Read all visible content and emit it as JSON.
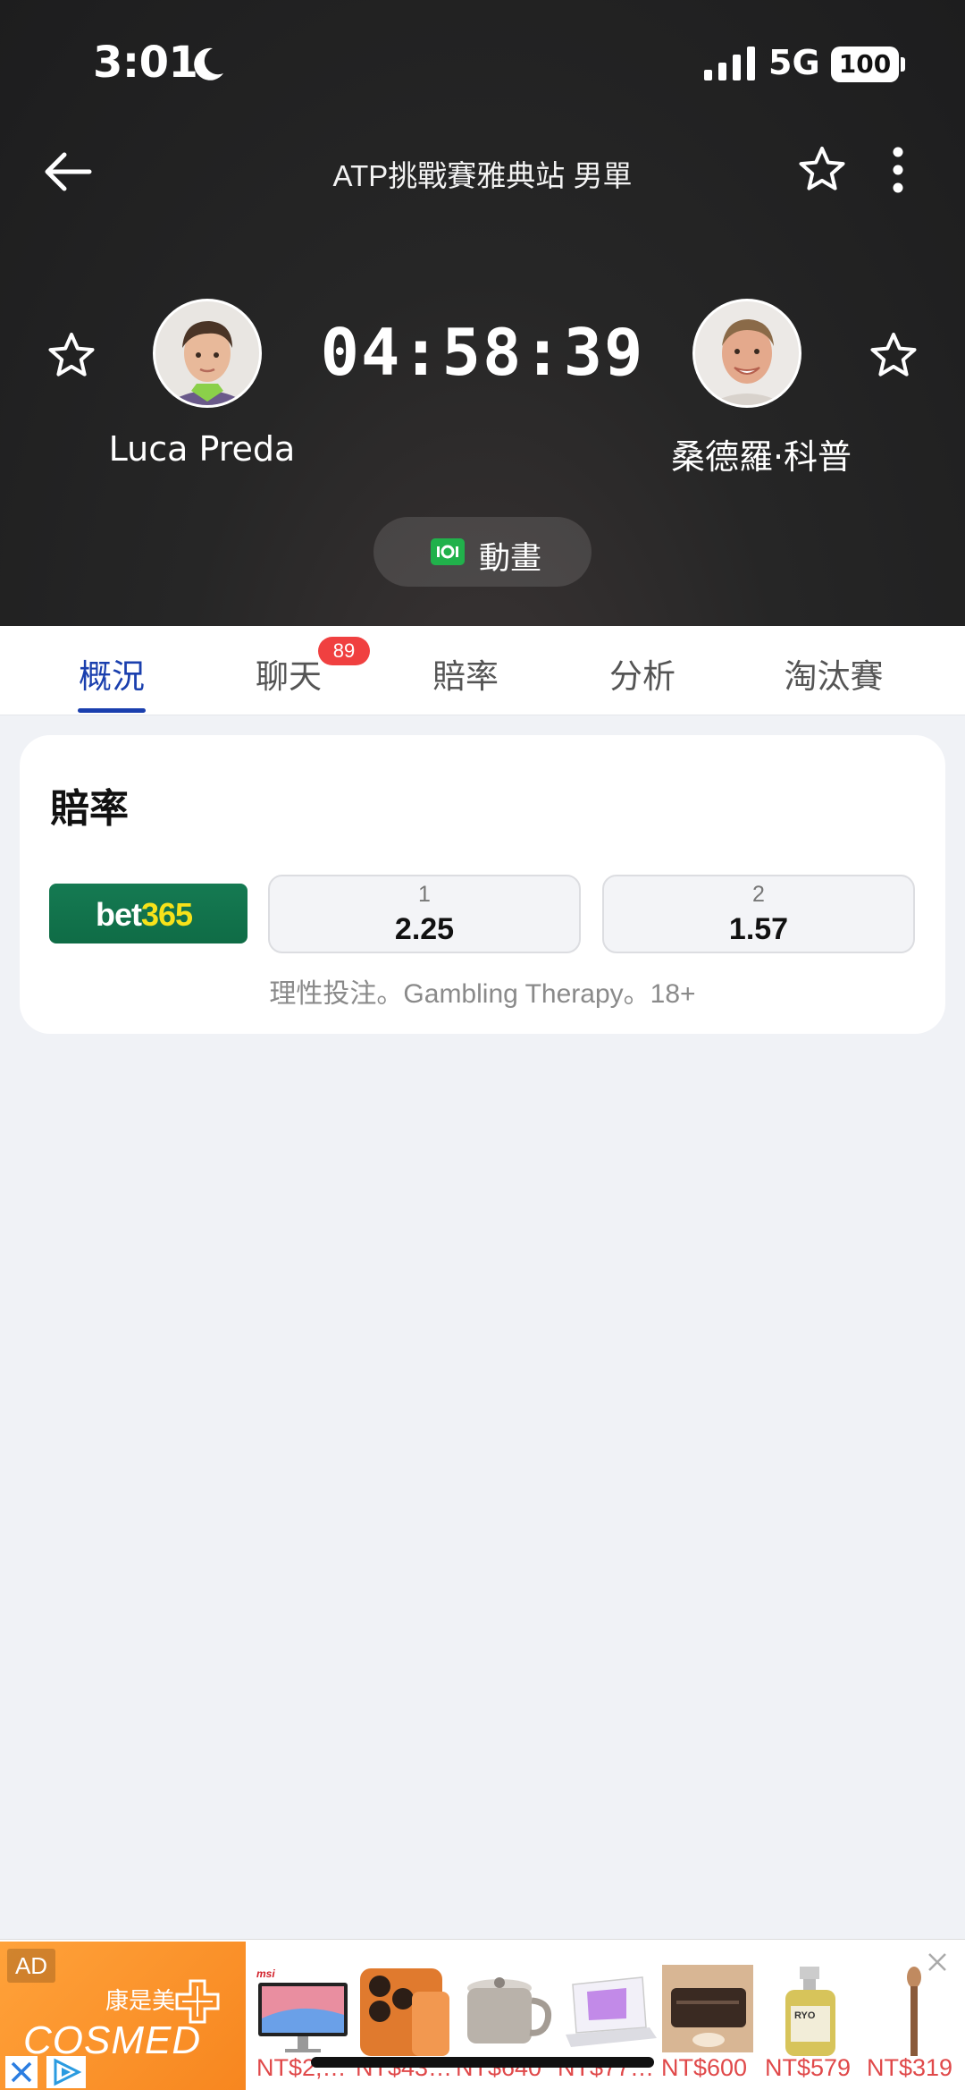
{
  "status_bar": {
    "time": "3:01",
    "network": "5G",
    "battery": "100",
    "icons": [
      "moon-icon",
      "signal-icon",
      "battery-icon"
    ]
  },
  "nav": {
    "title": "ATP挑戰賽雅典站 男單",
    "icons": [
      "back-arrow-icon",
      "star-icon",
      "more-vertical-icon"
    ]
  },
  "match": {
    "home_player": "Luca Preda",
    "away_player": "桑德羅·科普",
    "countdown": "04:58:39",
    "animation_label": "動畫"
  },
  "tabs": [
    {
      "label": "概況",
      "active": true
    },
    {
      "label": "聊天",
      "badge": "89"
    },
    {
      "label": "賠率"
    },
    {
      "label": "分析"
    },
    {
      "label": "淘汰賽"
    }
  ],
  "odds_card": {
    "title": "賠率",
    "bookmaker": {
      "part1": "bet",
      "part2": "365"
    },
    "options": [
      {
        "label": "1",
        "value": "2.25"
      },
      {
        "label": "2",
        "value": "1.57"
      }
    ],
    "note": "理性投注。Gambling Therapy。18+"
  },
  "ad": {
    "tag": "AD",
    "brand_sub": "康是美",
    "brand_name": "COSMED",
    "prices": [
      "NT$2,…",
      "NT$43…",
      "NT$640",
      "NT$77…",
      "NT$600",
      "NT$579",
      "NT$319"
    ]
  },
  "colors": {
    "accent": "#1a3fae",
    "badge": "#f04040",
    "bet365_green": "#157a52",
    "bet365_yellow": "#f7e21a",
    "ad_orange": "#f7861f",
    "price_red": "#e0494a"
  }
}
